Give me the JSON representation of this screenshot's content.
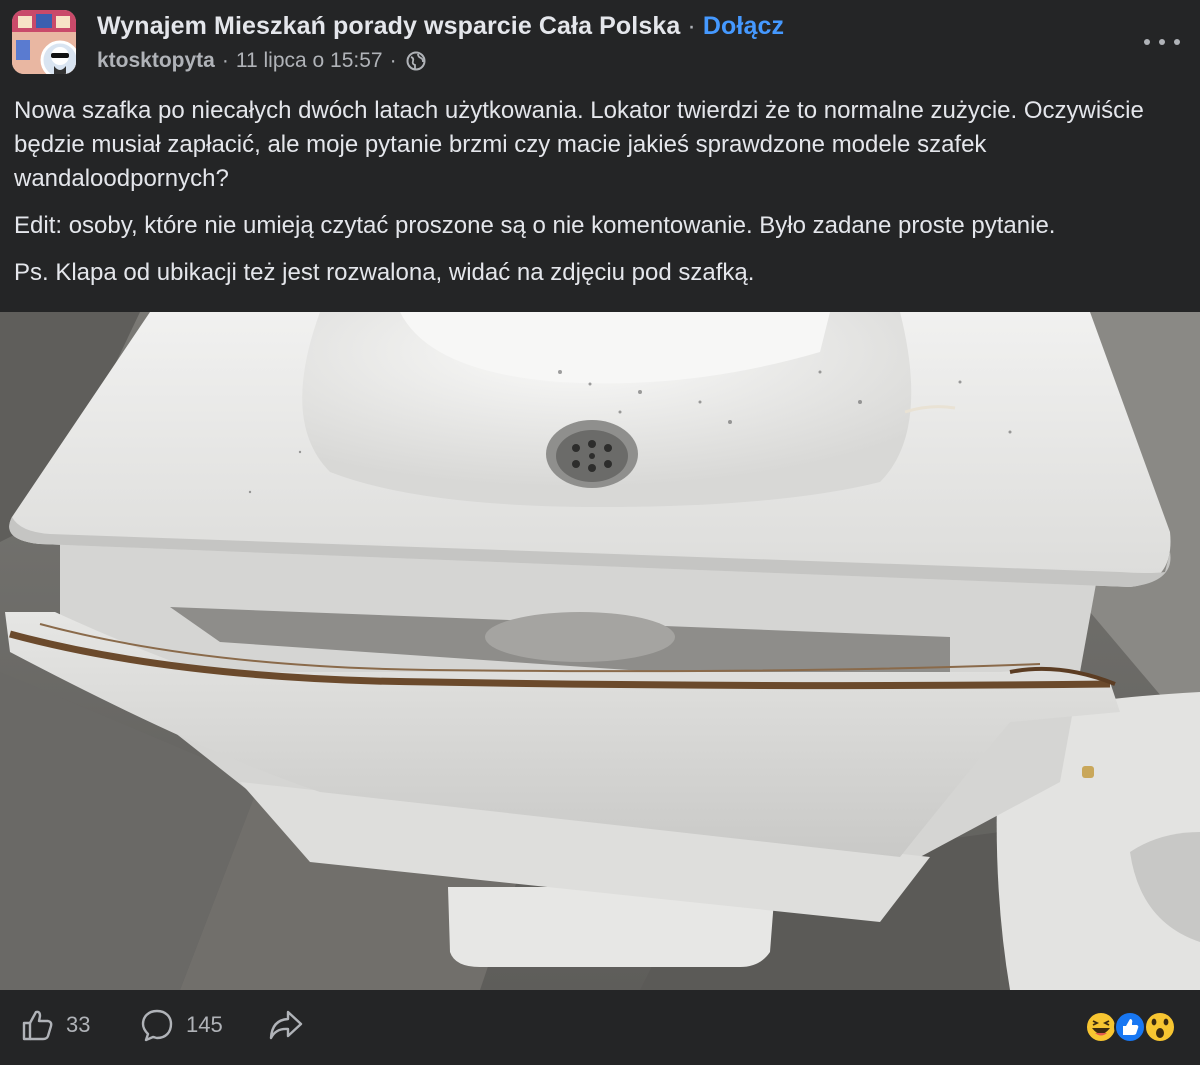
{
  "post": {
    "group_name": "Wynajem Mieszkań porady wsparcie Cała Polska",
    "separator": "·",
    "join_label": "Dołącz",
    "author": "ktosktopyta",
    "date": "11 lipca o 15:57",
    "privacy_icon": "globe-icon",
    "more_icon": "more-options-icon",
    "paragraphs": [
      "Nowa szafka po niecałych dwóch latach użytkowania. Lokator twierdzi że to normalne zużycie. Oczywiście będzie musiał zapłacić, ale moje pytanie brzmi czy macie jakieś sprawdzone modele szafek wandaloodpornych?",
      "Edit: osoby, które nie umieją czytać proszone są o nie komentowanie. Było zadane proste pytanie.",
      "Ps. Klapa od ubikacji też jest rozwalona, widać na zdjęciu pod szafką."
    ]
  },
  "footer": {
    "likes": "33",
    "comments": "145",
    "like_icon": "thumbs-up-icon",
    "comment_icon": "comment-icon",
    "share_icon": "share-icon",
    "reaction_icons": [
      "haha-reaction-icon",
      "like-reaction-icon",
      "wow-reaction-icon"
    ]
  },
  "colors": {
    "background": "#242526",
    "text": "#e4e6eb",
    "secondary_text": "#b0b3b8",
    "join_link": "#4599ff",
    "like_blue": "#1877f2",
    "reaction_yellow": "#f7c531"
  }
}
